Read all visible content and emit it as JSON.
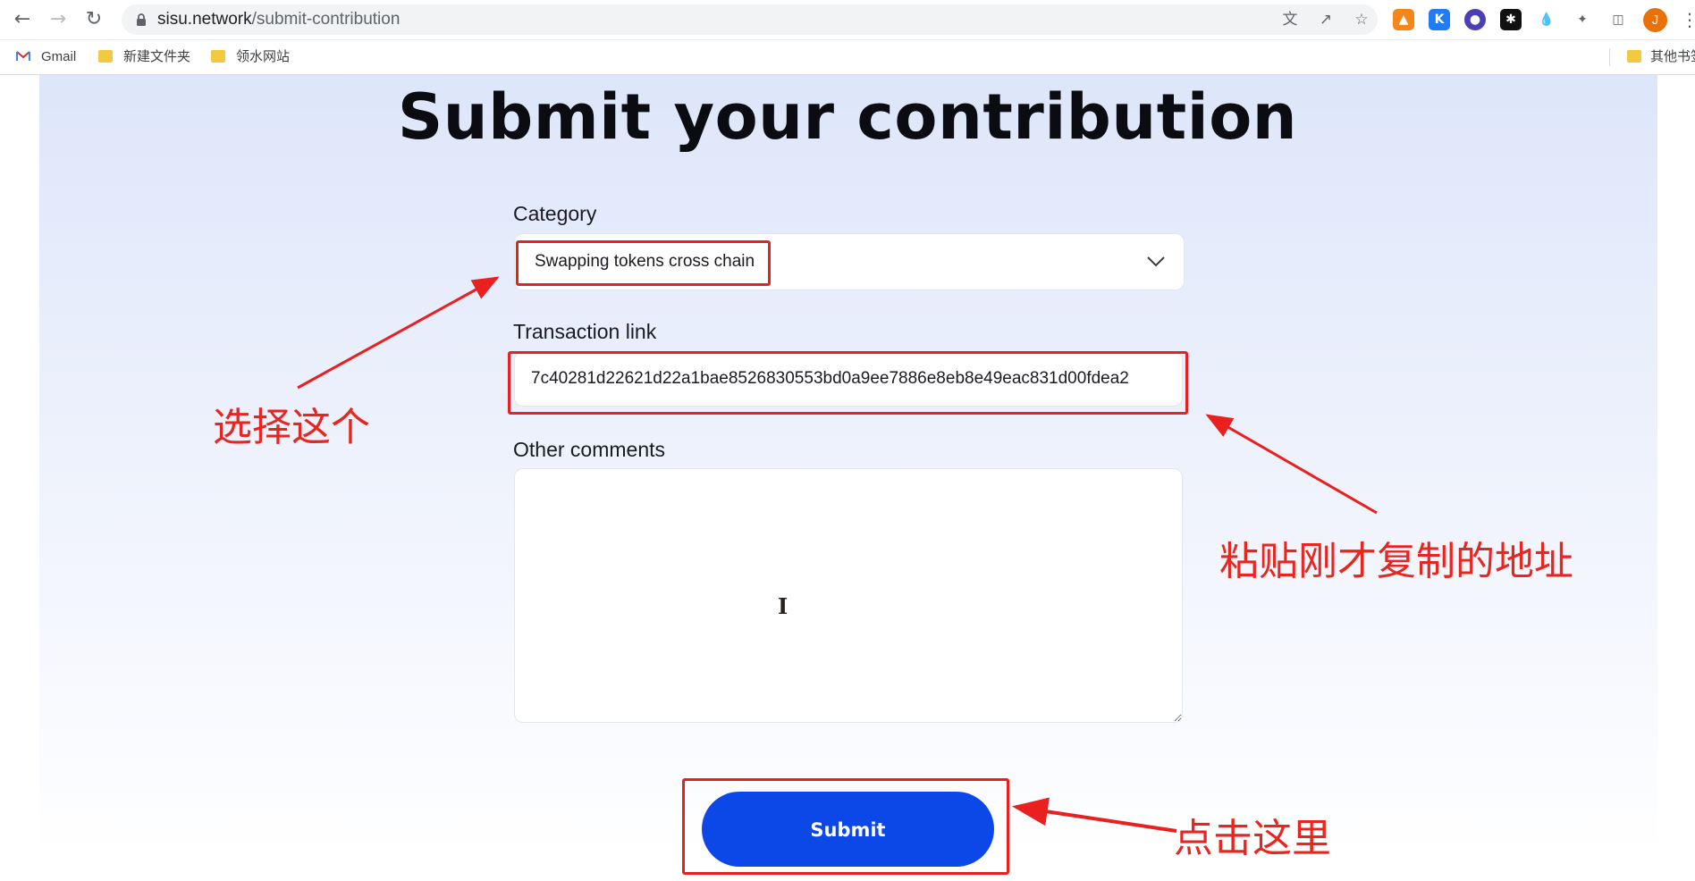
{
  "browser": {
    "url_domain": "sisu.network",
    "url_path": "/submit-contribution",
    "avatar_letter": "J",
    "bookmarks": [
      "Gmail",
      "新建文件夹",
      "领水网站"
    ],
    "other_bookmarks": "其他书签"
  },
  "page": {
    "title": "Submit your contribution",
    "category_label": "Category",
    "category_value": "Swapping tokens cross chain",
    "transaction_label": "Transaction link",
    "transaction_value": "7c40281d22621d22a1bae8526830553bd0a9ee7886e8eb8e49eac831d00fdea2",
    "comments_label": "Other comments",
    "submit_label": "Submit"
  },
  "annotations": {
    "select_note": "选择这个",
    "paste_note": "粘贴刚才复制的地址",
    "click_note": "点击这里",
    "color": "#ea1f1f"
  }
}
